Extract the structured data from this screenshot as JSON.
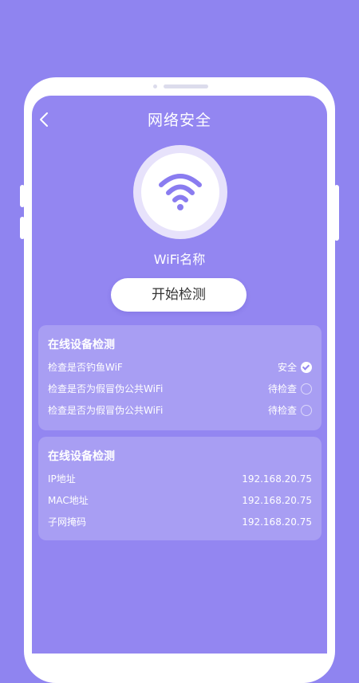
{
  "header": {
    "title": "网络安全"
  },
  "wifi": {
    "name": "WiFi名称"
  },
  "action": {
    "start_label": "开始检测"
  },
  "check_card": {
    "title": "在线设备检测",
    "items": [
      {
        "label": "检查是否钓鱼WiF",
        "status": "安全",
        "state": "ok"
      },
      {
        "label": "检查是否为假冒伪公共WiFi",
        "status": "待检查",
        "state": "pending"
      },
      {
        "label": "检查是否为假冒伪公共WiFi",
        "status": "待检查",
        "state": "pending"
      }
    ]
  },
  "info_card": {
    "title": "在线设备检测",
    "items": [
      {
        "label": "IP地址",
        "value": "192.168.20.75"
      },
      {
        "label": "MAC地址",
        "value": "192.168.20.75"
      },
      {
        "label": "子网掩码",
        "value": "192.168.20.75"
      }
    ]
  },
  "colors": {
    "background": "#8f84f0",
    "screen": "#9386f1",
    "accent": "#8a7cf0"
  },
  "icons": [
    "back-arrow-icon",
    "wifi-icon",
    "check-circle-icon",
    "pending-circle-icon"
  ]
}
